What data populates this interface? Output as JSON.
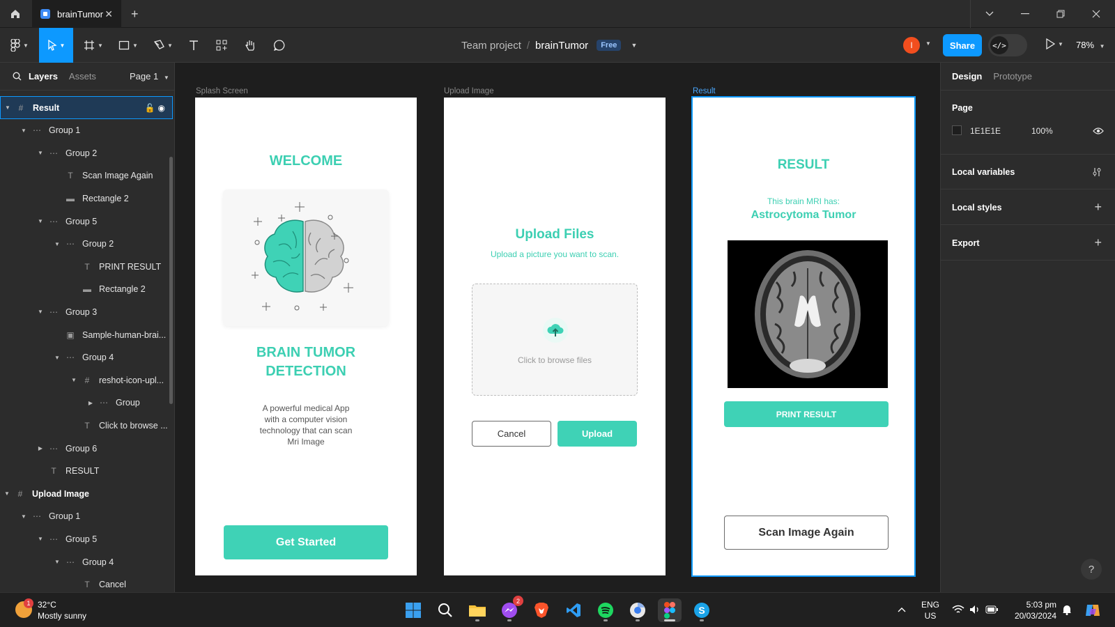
{
  "titlebar": {
    "tab_title": "brainTumor",
    "close": "✕",
    "new_tab": "+"
  },
  "toolbar": {
    "team": "Team project",
    "separator": "/",
    "file_name": "brainTumor",
    "plan_badge": "Free",
    "avatar_initial": "I",
    "share_label": "Share",
    "devmode_label": "</>",
    "zoom": "78%"
  },
  "left_panel": {
    "tab_layers": "Layers",
    "tab_assets": "Assets",
    "page_selector": "Page 1",
    "layers": [
      {
        "name": "Result",
        "icon": "frame-icon",
        "expanded": true,
        "selected": true
      },
      {
        "name": "Group 1",
        "icon": "group-icon",
        "expanded": true
      },
      {
        "name": "Group 2",
        "icon": "group-icon",
        "expanded": true
      },
      {
        "name": "Scan Image Again",
        "icon": "text-icon"
      },
      {
        "name": "Rectangle 2",
        "icon": "rectangle-icon"
      },
      {
        "name": "Group 5",
        "icon": "group-icon",
        "expanded": true
      },
      {
        "name": "Group 2",
        "icon": "group-icon",
        "expanded": true
      },
      {
        "name": "PRINT RESULT",
        "icon": "text-icon"
      },
      {
        "name": "Rectangle 2",
        "icon": "rectangle-icon"
      },
      {
        "name": "Group 3",
        "icon": "group-icon",
        "expanded": true
      },
      {
        "name": "Sample-human-brai...",
        "icon": "image-icon"
      },
      {
        "name": "Group 4",
        "icon": "group-icon",
        "expanded": true
      },
      {
        "name": "reshot-icon-upl...",
        "icon": "frame-icon",
        "expanded": true
      },
      {
        "name": "Group",
        "icon": "group-icon",
        "expanded": false
      },
      {
        "name": "Click to browse ...",
        "icon": "text-icon"
      },
      {
        "name": "Group 6",
        "icon": "group-icon",
        "expanded": false
      },
      {
        "name": "RESULT",
        "icon": "text-icon"
      },
      {
        "name": "Upload Image",
        "icon": "frame-icon",
        "expanded": true
      },
      {
        "name": "Group 1",
        "icon": "group-icon",
        "expanded": true
      },
      {
        "name": "Group 5",
        "icon": "group-icon",
        "expanded": true
      },
      {
        "name": "Group 4",
        "icon": "group-icon",
        "expanded": true
      },
      {
        "name": "Cancel",
        "icon": "text-icon"
      }
    ]
  },
  "canvas": {
    "splash": {
      "label": "Splash Screen",
      "welcome": "WELCOME",
      "title_line1": "BRAIN TUMOR",
      "title_line2": "DETECTION",
      "desc_line1": "A powerful medical App",
      "desc_line2": "with a computer vision",
      "desc_line3": "technology that can scan",
      "desc_line4": "Mri Image",
      "cta": "Get Started"
    },
    "upload": {
      "label": "Upload Image",
      "title": "Upload Files",
      "subtitle": "Upload a picture you want to scan.",
      "dropzone": "Click to browse files",
      "cancel": "Cancel",
      "upload": "Upload"
    },
    "result": {
      "label": "Result",
      "title": "RESULT",
      "sub": "This brain MRI has:",
      "diagnosis": "Astrocytoma Tumor",
      "print": "PRINT RESULT",
      "scan_again": "Scan Image Again"
    }
  },
  "right_panel": {
    "tab_design": "Design",
    "tab_prototype": "Prototype",
    "page_heading": "Page",
    "page_color": "1E1E1E",
    "page_opacity": "100%",
    "local_variables": "Local variables",
    "local_styles": "Local styles",
    "export": "Export",
    "help": "?"
  },
  "taskbar": {
    "notif_count": "1",
    "temperature": "32°C",
    "weather": "Mostly sunny",
    "messenger_badge": "2",
    "lang": "ENG",
    "region": "US",
    "time": "5:03 pm",
    "date": "20/03/2024"
  },
  "colors": {
    "accent": "#0d99ff",
    "teal": "#3fd2b6",
    "canvas": "#1e1e1e",
    "panel": "#2c2c2c"
  }
}
